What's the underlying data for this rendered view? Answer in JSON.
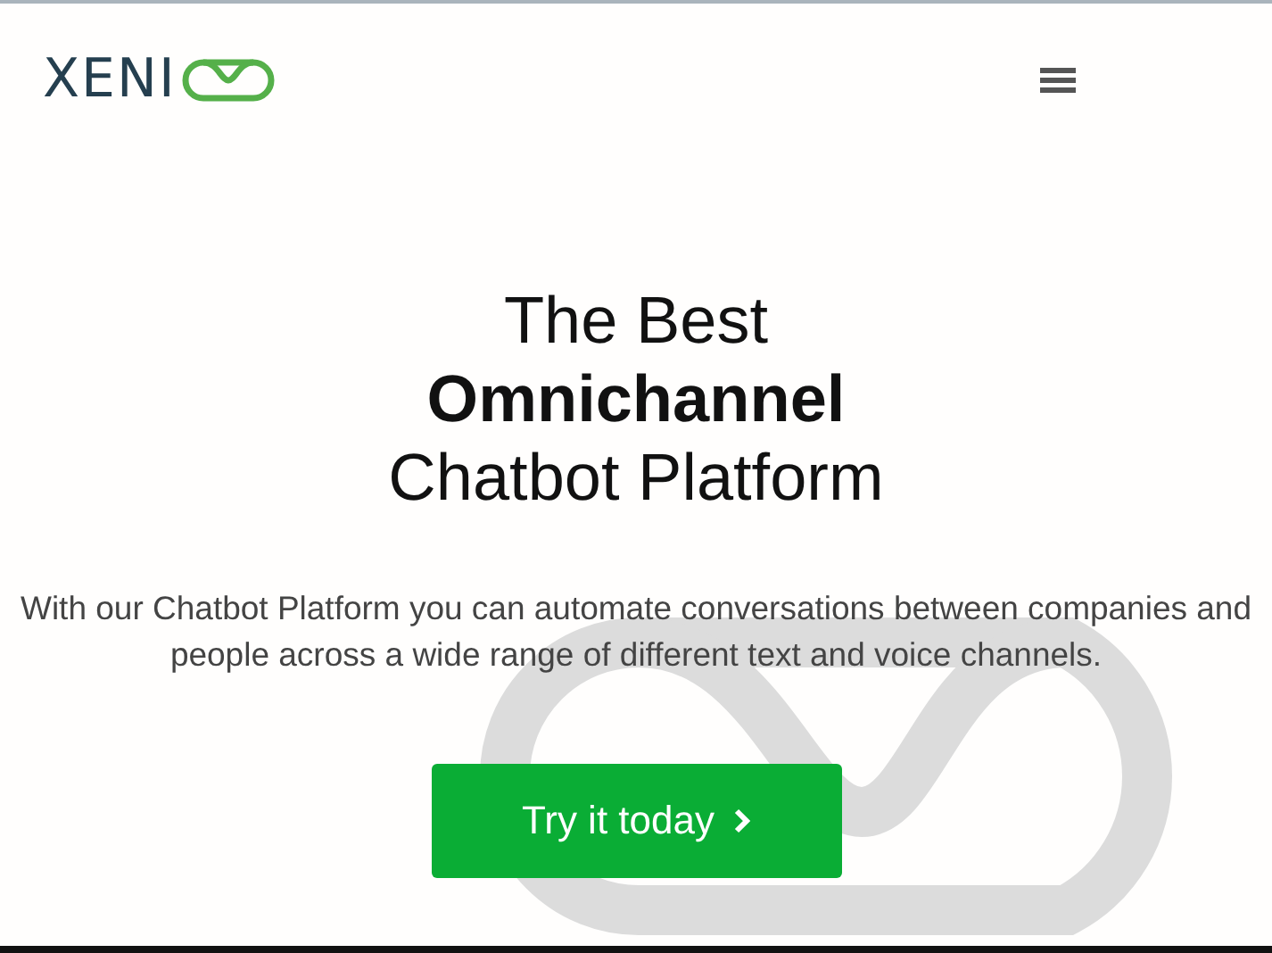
{
  "header": {
    "logo": {
      "text": "XENI"
    }
  },
  "hero": {
    "heading": "The Best\n**Omnichannel**\nChatbot Platform",
    "description": "With our Chatbot Platform you can automate conversations between companies and people across a wide range of different text and voice channels.",
    "button": {
      "label": "Try it today"
    }
  }
}
